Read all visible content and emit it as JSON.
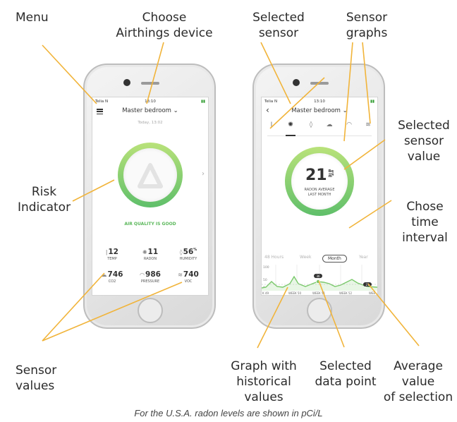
{
  "callouts": {
    "menu": "Menu",
    "choose_device": [
      "Choose",
      "Airthings device"
    ],
    "selected_sensor": [
      "Selected",
      "sensor"
    ],
    "sensor_graphs": [
      "Sensor",
      "graphs"
    ],
    "risk_indicator": [
      "Risk",
      "Indicator"
    ],
    "selected_sensor_value": [
      "Selected",
      "sensor",
      "value"
    ],
    "chose_time_interval": [
      "Chose",
      "time",
      "interval"
    ],
    "sensor_values": [
      "Sensor",
      "values"
    ],
    "graph_historical": [
      "Graph with",
      "historical",
      "values"
    ],
    "selected_data_point": [
      "Selected",
      "data point"
    ],
    "average_value": [
      "Average",
      "value",
      "of selection"
    ]
  },
  "footer": "For the U.S.A. radon levels are shown in pCi/L",
  "colors": {
    "callout_line": "#f1b43a",
    "ring_start": "#b9e27a",
    "ring_end": "#5fbf6a",
    "good": "#5cb85c"
  },
  "left_phone": {
    "status": {
      "carrier": "Telia N",
      "time": "13:10",
      "battery": "▮"
    },
    "title": "Master bedroom ⌄",
    "date": "Today, 13:02",
    "status_text": "AIR QUALITY IS GOOD",
    "sensors": [
      {
        "icon": "thermometer-icon",
        "glyph": "🌡",
        "value": "12",
        "unit": "",
        "label": "TEMP"
      },
      {
        "icon": "radon-icon",
        "glyph": "✺",
        "value": "11",
        "unit": "",
        "label": "RADON"
      },
      {
        "icon": "humidity-icon",
        "glyph": "💧",
        "value": "56",
        "unit": "%",
        "label": "HUMIDITY"
      },
      {
        "icon": "cloud-icon",
        "glyph": "☁",
        "value": "746",
        "unit": "",
        "label": "CO2"
      },
      {
        "icon": "gauge-icon",
        "glyph": "◠",
        "value": "986",
        "unit": "",
        "label": "PRESSURE"
      },
      {
        "icon": "voc-icon",
        "glyph": "≋",
        "value": "740",
        "unit": "",
        "label": "VOC"
      }
    ]
  },
  "right_phone": {
    "status": {
      "carrier": "Telia N",
      "time": "13:10",
      "battery": "▮"
    },
    "title": "Master bedroom ⌄",
    "back": "‹",
    "tabs": [
      "thermometer-icon",
      "radon-icon",
      "humidity-icon",
      "cloud-icon",
      "gauge-icon",
      "voc-icon"
    ],
    "value": "21",
    "unit_top": "Bq",
    "unit_bottom": "m³",
    "caption_1": "RADON AVERAGE",
    "caption_2": "LAST MONTH",
    "intervals": [
      "48 Hours",
      "Week",
      "Month",
      "Year"
    ],
    "selected_interval": "Month",
    "graph": {
      "y_ticks": [
        "100",
        "50",
        "0"
      ],
      "x_labels": [
        "K 49",
        "WEEK 50",
        "WEEK 51",
        "WEEK 52",
        "WEE"
      ],
      "selected_point_label": "36",
      "average_label": "21"
    }
  }
}
